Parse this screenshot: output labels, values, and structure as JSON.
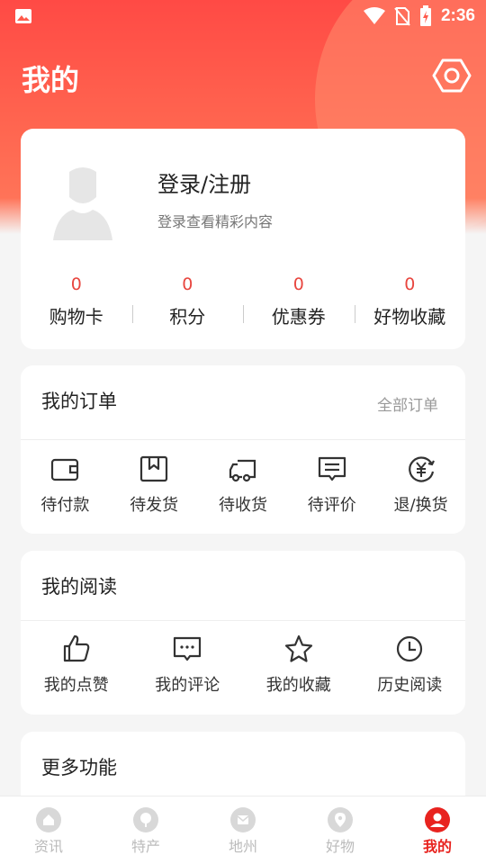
{
  "status_bar": {
    "time": "2:36"
  },
  "header": {
    "title": "我的"
  },
  "profile": {
    "login_title": "登录/注册",
    "login_subtitle": "登录查看精彩内容",
    "stats": [
      {
        "value": "0",
        "label": "购物卡"
      },
      {
        "value": "0",
        "label": "积分"
      },
      {
        "value": "0",
        "label": "优惠券"
      },
      {
        "value": "0",
        "label": "好物收藏"
      }
    ]
  },
  "orders": {
    "title": "我的订单",
    "all_link": "全部订单",
    "items": [
      {
        "label": "待付款",
        "icon": "wallet-icon"
      },
      {
        "label": "待发货",
        "icon": "box-icon"
      },
      {
        "label": "待收货",
        "icon": "truck-icon"
      },
      {
        "label": "待评价",
        "icon": "comment-icon"
      },
      {
        "label": "退/换货",
        "icon": "refund-icon"
      }
    ]
  },
  "reading": {
    "title": "我的阅读",
    "items": [
      {
        "label": "我的点赞",
        "icon": "thumbs-up-icon"
      },
      {
        "label": "我的评论",
        "icon": "chat-icon"
      },
      {
        "label": "我的收藏",
        "icon": "star-icon"
      },
      {
        "label": "历史阅读",
        "icon": "clock-icon"
      }
    ]
  },
  "more": {
    "title": "更多功能"
  },
  "tabbar": {
    "tabs": [
      {
        "label": "资讯",
        "icon": "home-icon"
      },
      {
        "label": "特产",
        "icon": "tree-icon"
      },
      {
        "label": "地州",
        "icon": "mail-icon"
      },
      {
        "label": "好物",
        "icon": "location-icon"
      },
      {
        "label": "我的",
        "icon": "user-icon"
      }
    ],
    "active_index": 4
  },
  "colors": {
    "accent": "#e8231f",
    "header_gradient_top": "#ff4a45",
    "stat_value": "#e8463f"
  }
}
